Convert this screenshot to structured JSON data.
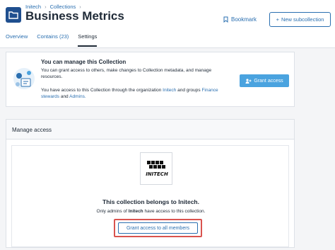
{
  "breadcrumb": {
    "org": "Initech",
    "collections": "Collections"
  },
  "page": {
    "title": "Business Metrics"
  },
  "actions": {
    "bookmark": "Bookmark",
    "new_subcollection": "New subcollection"
  },
  "tabs": [
    {
      "label": "Overview",
      "active": false
    },
    {
      "label": "Contains (23)",
      "active": false
    },
    {
      "label": "Settings",
      "active": true
    }
  ],
  "manage": {
    "title": "You can manage this Collection",
    "desc": "You can grant access to others, make changes to Collection metadata, and manage resources.",
    "org_prefix": "You have access to this Collection through the organization",
    "org_name": "Initech",
    "groups_text": "and groups",
    "group1": "Finance stewards",
    "and_text": "and",
    "group2": "Admins.",
    "grant_button": "Grant access"
  },
  "access": {
    "heading": "Manage access",
    "logo_text": "INITECH",
    "belongs": "This collection belongs to Initech.",
    "admins_prefix": "Only admins of",
    "admins_org": "Initech",
    "admins_suffix": "have access to this collection.",
    "grant_all_button": "Grant access to all members"
  },
  "colors": {
    "accent": "#2a6fb0",
    "button_fill": "#4aa3df",
    "highlight": "#d9534f",
    "icon_bg": "#1f4f8f"
  }
}
